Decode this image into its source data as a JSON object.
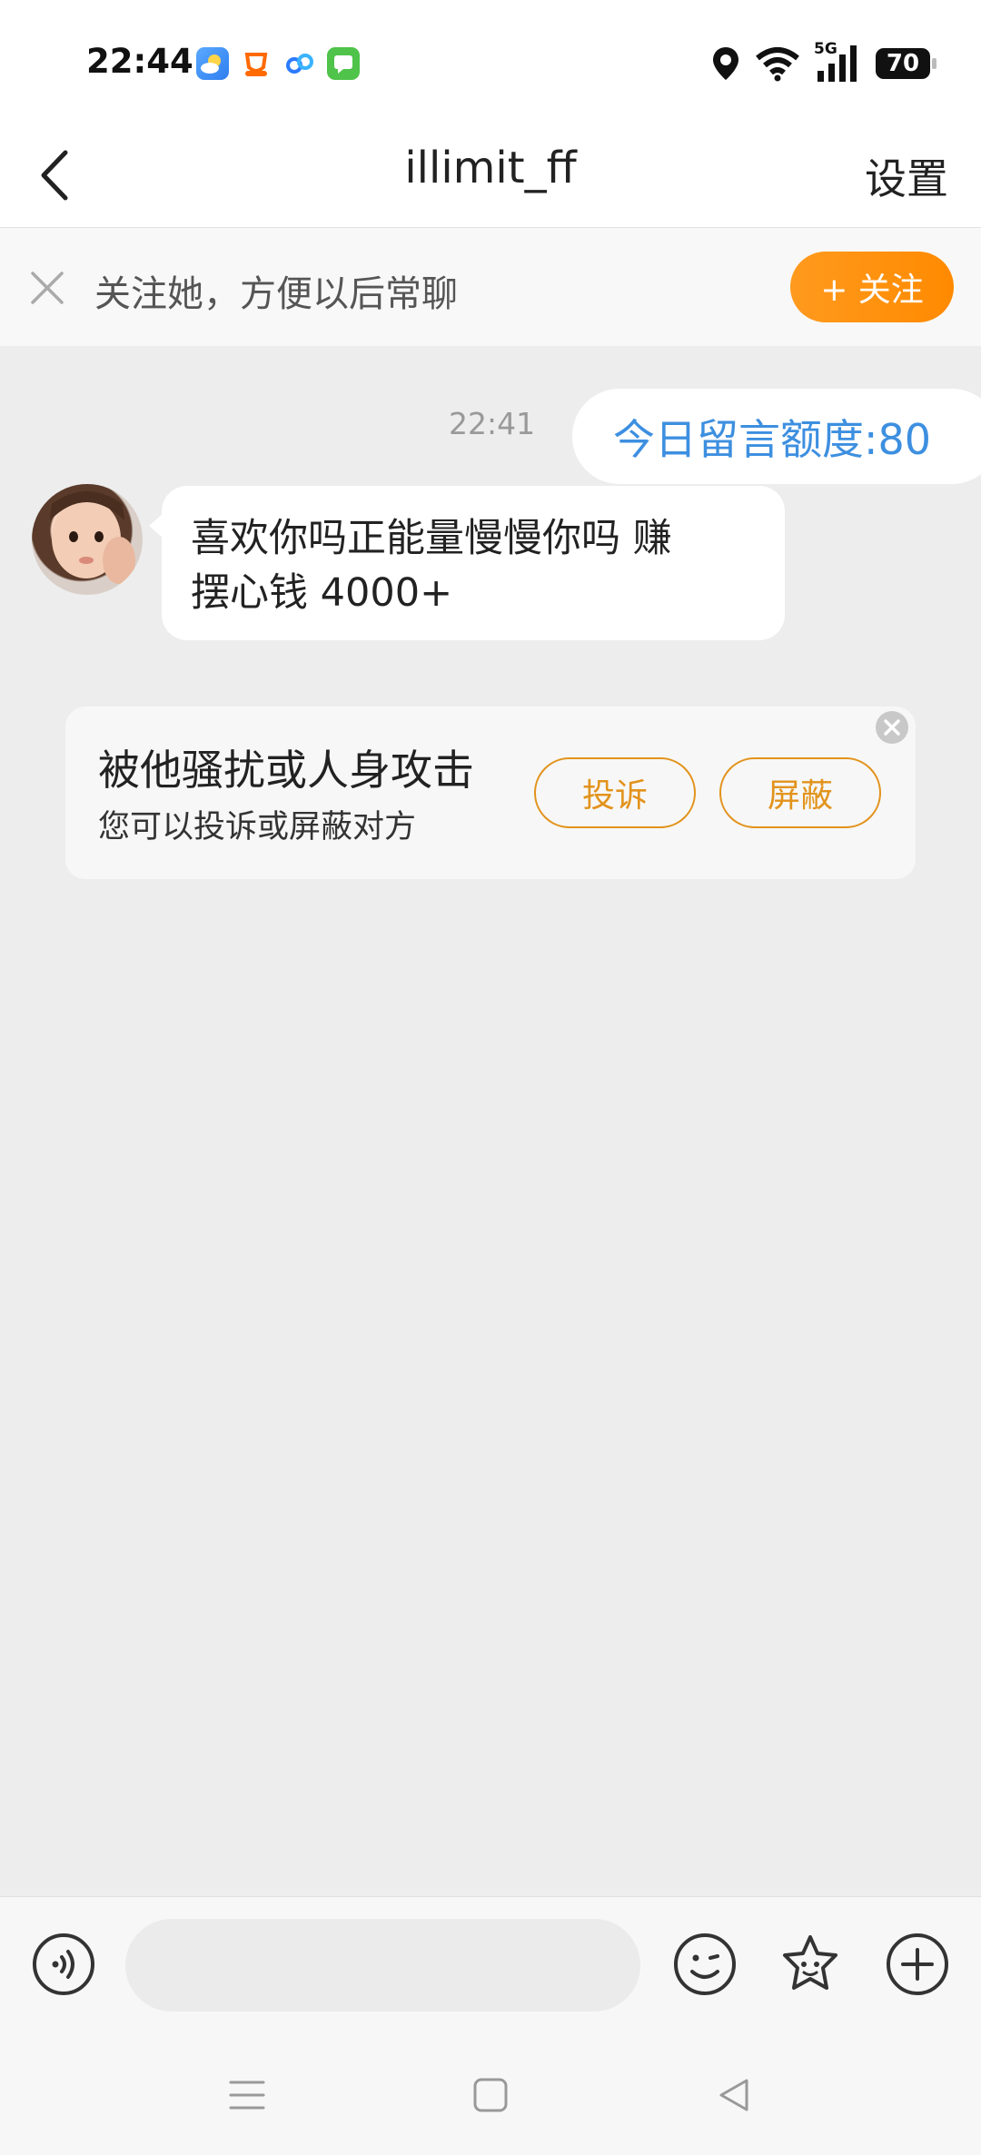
{
  "status_bar": {
    "time": "22:44",
    "network": "5G",
    "battery": "70",
    "app_icons": [
      "weather-app-icon",
      "taobao-app-icon",
      "baidu-netdisk-app-icon",
      "messages-app-icon"
    ]
  },
  "header": {
    "title": "illimit_ff",
    "settings_label": "设置"
  },
  "follow_bar": {
    "text": "关注她，方便以后常聊",
    "button_label": "+ 关注"
  },
  "chat": {
    "timestamp": "22:41",
    "outgoing_message": "今日留言额度:80",
    "incoming_message_line1": "喜欢你吗正能量慢慢你吗 赚",
    "incoming_message_line2": "摆心钱 4000+"
  },
  "report_card": {
    "title": "被他骚扰或人身攻击",
    "subtitle": "您可以投诉或屏蔽对方",
    "report_label": "投诉",
    "block_label": "屏蔽"
  },
  "colors": {
    "accent_orange": "#ff8a00",
    "quota_blue": "#3d8fe0",
    "background": "#ededed"
  }
}
